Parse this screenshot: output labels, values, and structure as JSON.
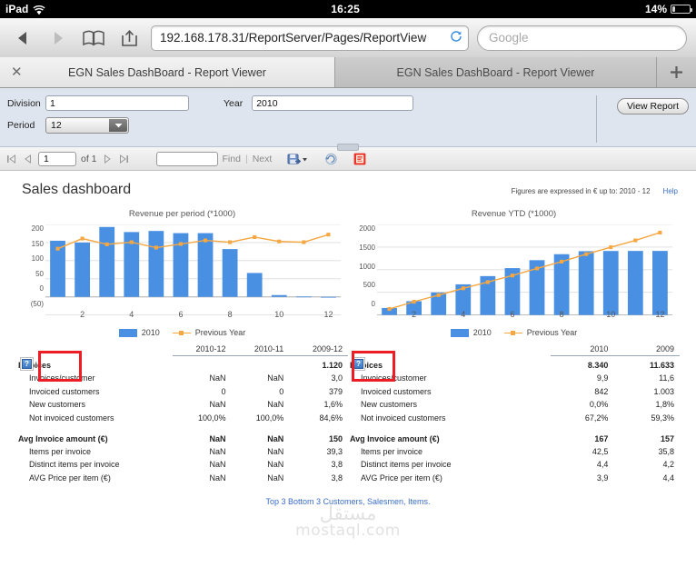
{
  "status_bar": {
    "device": "iPad",
    "wifi_icon": "wifi-icon",
    "time": "16:25",
    "battery_percent": "14%",
    "battery_level": 14
  },
  "browser": {
    "back_icon": "back-arrow-icon",
    "forward_icon": "forward-arrow-icon",
    "bookmarks_icon": "book-icon",
    "share_icon": "share-icon",
    "url": "192.168.178.31/ReportServer/Pages/ReportView",
    "reload_icon": "reload-icon",
    "search_placeholder": "Google"
  },
  "tabs": {
    "close_icon": "close-icon",
    "add_icon": "plus-icon",
    "items": [
      {
        "label": "EGN Sales DashBoard - Report Viewer",
        "active": true
      },
      {
        "label": "EGN Sales DashBoard - Report Viewer",
        "active": false
      }
    ]
  },
  "params": {
    "division_label": "Division",
    "division_value": "1",
    "year_label": "Year",
    "year_value": "2010",
    "period_label": "Period",
    "period_value": "12",
    "period_arrow_icon": "chevron-down-icon",
    "view_report_label": "View Report"
  },
  "report_toolbar": {
    "first_icon": "first-page-icon",
    "prev_icon": "prev-page-icon",
    "page_value": "1",
    "of_label": "of 1",
    "next_icon": "next-page-icon",
    "last_icon": "last-page-icon",
    "find_value": "",
    "find_label": "Find",
    "separator": "|",
    "next_label": "Next",
    "export_icon": "export-save-icon",
    "export_caret_icon": "caret-down-icon",
    "refresh_icon": "refresh-icon",
    "print_icon": "print-report-icon"
  },
  "report": {
    "title": "Sales dashboard",
    "meta": "Figures are expressed in € up to: 2010 - 12",
    "help_label": "Help",
    "bottom_link": "Top 3 Bottom 3 Customers, Salesmen, Items.",
    "watermark_line1": "مستقل",
    "watermark_line2": "mostaql.com"
  },
  "chart_data": [
    {
      "type": "bar",
      "title": "Revenue per period (*1000)",
      "xlabel": "",
      "ylabel": "",
      "categories": [
        "1",
        "2",
        "3",
        "4",
        "5",
        "6",
        "7",
        "8",
        "9",
        "10",
        "11",
        "12"
      ],
      "x_tick_labels": [
        "2",
        "4",
        "6",
        "8",
        "10",
        "12"
      ],
      "y_tick_labels": [
        "200",
        "150",
        "100",
        "50",
        "0",
        "(50)"
      ],
      "ylim": [
        -50,
        200
      ],
      "grid": true,
      "legend_position": "bottom",
      "series": [
        {
          "name": "2010",
          "type": "bar",
          "color": "#4a90e2",
          "values": [
            155,
            150,
            193,
            179,
            182,
            176,
            176,
            132,
            66,
            5,
            1,
            0
          ]
        },
        {
          "name": "Previous Year",
          "type": "line",
          "color": "#f5a742",
          "values": [
            133,
            161,
            145,
            151,
            136,
            146,
            156,
            151,
            165,
            153,
            151,
            172
          ]
        }
      ]
    },
    {
      "type": "bar",
      "title": "Revenue YTD (*1000)",
      "xlabel": "",
      "ylabel": "",
      "categories": [
        "1",
        "2",
        "3",
        "4",
        "5",
        "6",
        "7",
        "8",
        "9",
        "10",
        "11",
        "12"
      ],
      "x_tick_labels": [
        "2",
        "4",
        "6",
        "8",
        "10",
        "12"
      ],
      "y_tick_labels": [
        "2000",
        "1500",
        "1000",
        "500",
        "0"
      ],
      "ylim": [
        0,
        2000
      ],
      "grid": true,
      "legend_position": "bottom",
      "series": [
        {
          "name": "2010",
          "type": "bar",
          "color": "#4a90e2",
          "values": [
            155,
            305,
            498,
            677,
            859,
            1035,
            1211,
            1343,
            1409,
            1414,
            1415,
            1415
          ]
        },
        {
          "name": "Previous Year",
          "type": "line",
          "color": "#f5a742",
          "values": [
            133,
            294,
            439,
            590,
            726,
            872,
            1028,
            1179,
            1344,
            1497,
            1648,
            1820
          ]
        }
      ]
    }
  ],
  "left_table": {
    "columns": [
      "",
      "2010-12",
      "2010-11",
      "2009-12"
    ],
    "broken_image_icon": "broken-image-icon",
    "rows": [
      {
        "label": "Invoices",
        "group": true,
        "values": [
          "",
          "",
          "1.120"
        ]
      },
      {
        "label": "Invoices/customer",
        "group": false,
        "values": [
          "NaN",
          "NaN",
          "3,0"
        ]
      },
      {
        "label": "Invoiced customers",
        "group": false,
        "values": [
          "0",
          "0",
          "379"
        ]
      },
      {
        "label": "New customers",
        "group": false,
        "values": [
          "NaN",
          "NaN",
          "1,6%"
        ]
      },
      {
        "label": "Not invoiced customers",
        "group": false,
        "values": [
          "100,0%",
          "100,0%",
          "84,6%"
        ]
      },
      {
        "label": "Avg Invoice amount (€)",
        "group": true,
        "values": [
          "NaN",
          "NaN",
          "150"
        ]
      },
      {
        "label": "Items per invoice",
        "group": false,
        "values": [
          "NaN",
          "NaN",
          "39,3"
        ]
      },
      {
        "label": "Distinct items per invoice",
        "group": false,
        "values": [
          "NaN",
          "NaN",
          "3,8"
        ]
      },
      {
        "label": "AVG Price per item (€)",
        "group": false,
        "values": [
          "NaN",
          "NaN",
          "3,8"
        ]
      }
    ]
  },
  "right_table": {
    "columns": [
      "",
      "2010",
      "2009"
    ],
    "broken_image_icon": "broken-image-icon",
    "rows": [
      {
        "label": "Invoices",
        "group": true,
        "values": [
          "8.340",
          "11.633"
        ]
      },
      {
        "label": "Invoices/customer",
        "group": false,
        "values": [
          "9,9",
          "11,6"
        ]
      },
      {
        "label": "Invoiced customers",
        "group": false,
        "values": [
          "842",
          "1.003"
        ]
      },
      {
        "label": "New customers",
        "group": false,
        "values": [
          "0,0%",
          "1,8%"
        ]
      },
      {
        "label": "Not invoiced customers",
        "group": false,
        "values": [
          "67,2%",
          "59,3%"
        ]
      },
      {
        "label": "Avg Invoice amount (€)",
        "group": true,
        "values": [
          "167",
          "157"
        ]
      },
      {
        "label": "Items per invoice",
        "group": false,
        "values": [
          "42,5",
          "35,8"
        ]
      },
      {
        "label": "Distinct items per invoice",
        "group": false,
        "values": [
          "4,4",
          "4,2"
        ]
      },
      {
        "label": "AVG Price per item (€)",
        "group": false,
        "values": [
          "3,9",
          "4,4"
        ]
      }
    ]
  },
  "colors": {
    "bar": "#4a90e2",
    "line": "#f5a742",
    "link": "#3b6ec4",
    "annotation": "#ee1c25",
    "panel": "#dfe5ee"
  }
}
